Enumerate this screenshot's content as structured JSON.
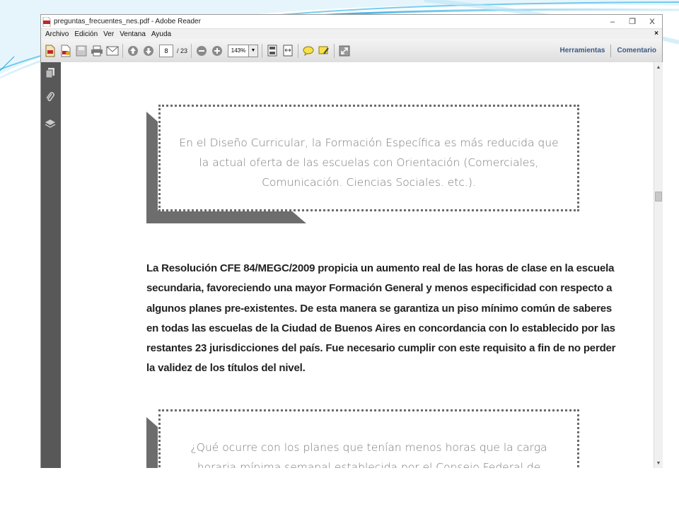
{
  "window": {
    "title": "preguntas_frecuentes_nes.pdf - Adobe Reader",
    "controls": {
      "minimize": "–",
      "restore": "❐",
      "close": "X"
    }
  },
  "menubar": {
    "items": [
      "Archivo",
      "Edición",
      "Ver",
      "Ventana",
      "Ayuda"
    ],
    "close_doc": "×"
  },
  "toolbar": {
    "current_page": "8",
    "total_pages": "/ 23",
    "zoom": "143%",
    "tools_label": "Herramientas",
    "comment_label": "Comentario"
  },
  "document": {
    "quote1": [
      "En el Diseño Curricular, la Formación Específica es más reducida que",
      "la actual oferta de las escuelas con Orientación (Comerciales,",
      "Comunicación. Ciencias Sociales. etc.)."
    ],
    "paragraph": [
      "La Resolución CFE 84/MEGC/2009 propicia un aumento real de las horas de clase en la escuela",
      "secundaria, favoreciendo una mayor Formación General y menos especificidad con respecto a",
      "algunos planes pre-existentes. De esta manera se garantiza un piso mínimo común de saberes",
      "en todas las escuelas de la Ciudad de Buenos Aires en concordancia con lo establecido por las",
      "restantes 23 jurisdicciones del país. Fue necesario cumplir con este requisito a fin de no perder",
      "la validez de los títulos del nivel."
    ],
    "quote2": [
      "¿Qué ocurre con los planes que tenían menos horas que la carga",
      "horaria mínima semanal establecida por el Consejo Federal de"
    ]
  },
  "colors": {
    "slide_accent": "#3fb6e8",
    "toolbar_link": "#3b5a83",
    "left_panel": "#585858",
    "quote_shadow": "#6d6d6d"
  }
}
